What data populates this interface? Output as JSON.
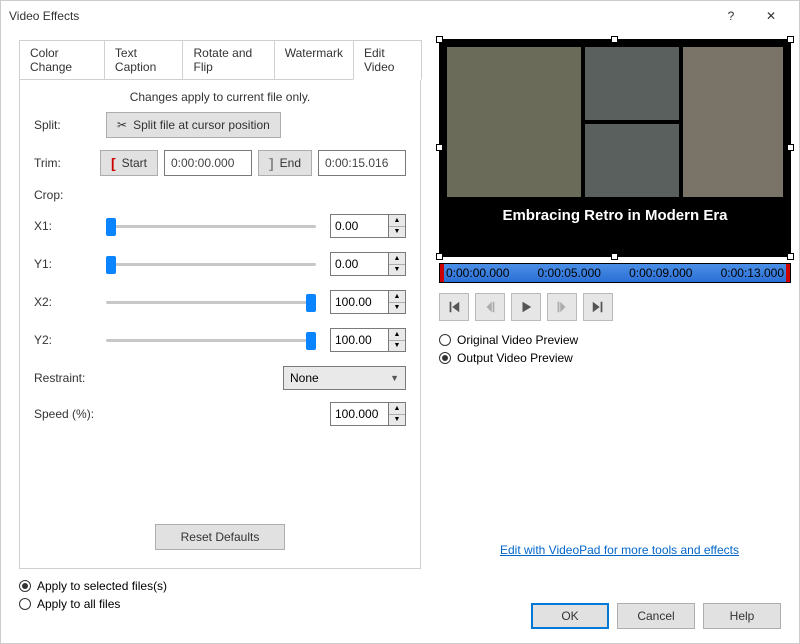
{
  "window": {
    "title": "Video Effects"
  },
  "tabs": [
    "Color Change",
    "Text Caption",
    "Rotate and Flip",
    "Watermark",
    "Edit Video"
  ],
  "active_tab_index": 4,
  "notice": "Changes apply to current file only.",
  "split": {
    "label": "Split:",
    "button": "Split file at cursor position"
  },
  "trim": {
    "label": "Trim:",
    "start_label": "Start",
    "start_value": "0:00:00.000",
    "end_label": "End",
    "end_value": "0:00:15.016"
  },
  "crop": {
    "label": "Crop:",
    "x1": {
      "label": "X1:",
      "value": "0.00",
      "pos": 0
    },
    "y1": {
      "label": "Y1:",
      "value": "0.00",
      "pos": 0
    },
    "x2": {
      "label": "X2:",
      "value": "100.00",
      "pos": 100
    },
    "y2": {
      "label": "Y2:",
      "value": "100.00",
      "pos": 100
    }
  },
  "restraint": {
    "label": "Restraint:",
    "value": "None"
  },
  "speed": {
    "label": "Speed (%):",
    "value": "100.000"
  },
  "reset_label": "Reset Defaults",
  "apply": {
    "selected": "Apply to selected files(s)",
    "all": "Apply to all files",
    "choice": "selected"
  },
  "preview": {
    "caption": "Embracing Retro in Modern Era",
    "timeline_marks": [
      "0:00:00.000",
      "0:00:05.000",
      "0:00:09.000",
      "0:00:13.000"
    ],
    "original_label": "Original Video Preview",
    "output_label": "Output Video Preview",
    "mode": "output"
  },
  "link": "Edit with VideoPad for more tools and effects",
  "buttons": {
    "ok": "OK",
    "cancel": "Cancel",
    "help": "Help"
  }
}
